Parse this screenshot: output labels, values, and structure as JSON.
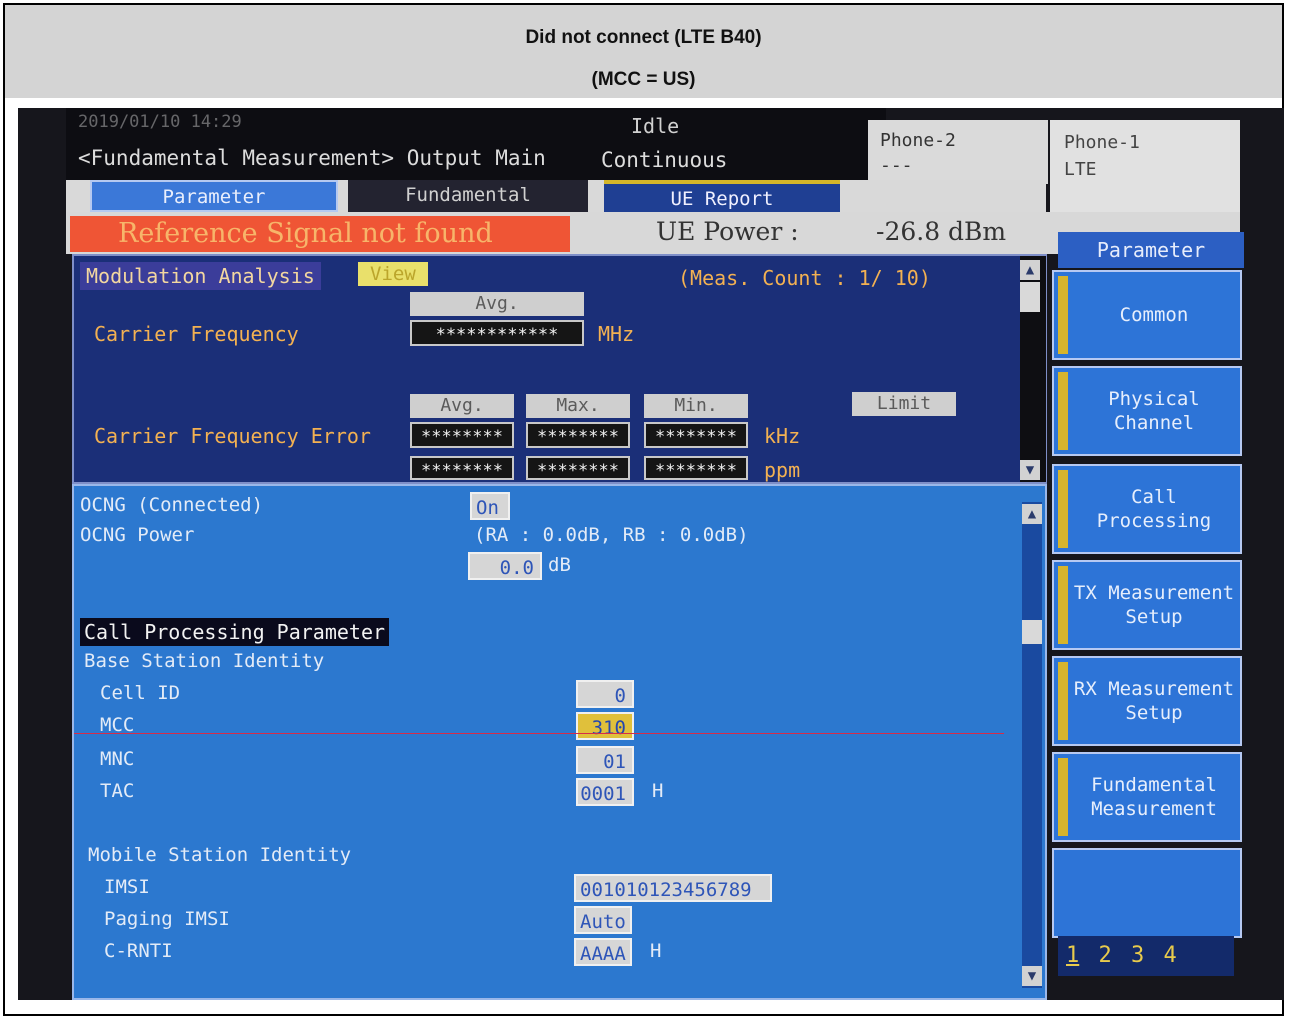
{
  "caption": {
    "title": "Did not connect (LTE B40)",
    "subtitle": "(MCC = US)"
  },
  "status_bar": {
    "timestamp_faded": "2019/01/10 14:29",
    "screen_title": "<Fundamental Measurement> Output Main",
    "state": "Idle",
    "mode": "Continuous",
    "phone2": {
      "label": "Phone-2",
      "value": "---"
    },
    "phone1": {
      "label": "Phone-1",
      "value": "LTE"
    }
  },
  "tabs": [
    {
      "label": "Parameter"
    },
    {
      "label": "Fundamental"
    },
    {
      "label": "UE Report"
    }
  ],
  "alert": {
    "text": "Reference Signal not found",
    "ue_power_label": "UE Power :",
    "ue_power_value": "-26.8 dBm"
  },
  "modulation": {
    "title": "Modulation Analysis",
    "view_label": "View",
    "meas_count": "(Meas. Count :   1/  10)",
    "avg_header": "Avg.",
    "carrier_frequency_label": "Carrier Frequency",
    "carrier_frequency_value": "************",
    "carrier_frequency_unit": "MHz",
    "headers": [
      "Avg.",
      "Max.",
      "Min."
    ],
    "limit_label": "Limit",
    "cfe_label": "Carrier Frequency Error",
    "cfe_values": [
      "********",
      "********",
      "********"
    ],
    "cfe_unit": "kHz",
    "cfe_values_row2": [
      "********",
      "********",
      "********"
    ],
    "cfe_unit_row2": "ppm"
  },
  "params": {
    "ocng_connected_label": "OCNG (Connected)",
    "ocng_connected_value": "On",
    "ocng_power_label": "OCNG Power",
    "ocng_power_info": "(RA :      0.0dB, RB :       0.0dB)",
    "ocng_power_value": "0.0",
    "ocng_power_unit": "dB",
    "section_title": "Call Processing Parameter",
    "bs_identity": "Base Station Identity",
    "cell_id_label": "Cell ID",
    "cell_id_value": "0",
    "mcc_label": "MCC",
    "mcc_value": "310",
    "mnc_label": "MNC",
    "mnc_value": "01",
    "tac_label": "TAC",
    "tac_value": "0001",
    "tac_unit": "H",
    "ms_identity": "Mobile Station Identity",
    "imsi_label": "IMSI",
    "imsi_value": "001010123456789",
    "paging_imsi_label": "Paging IMSI",
    "paging_imsi_value": "Auto",
    "crnti_label": "C-RNTI",
    "crnti_value": "AAAA",
    "crnti_unit": "H"
  },
  "sidebar": {
    "header": "Parameter",
    "buttons": [
      {
        "label": "Common"
      },
      {
        "label": "Physical Channel"
      },
      {
        "label": "Call Processing"
      },
      {
        "label": "TX Measurement Setup"
      },
      {
        "label": "RX Measurement Setup"
      },
      {
        "label": "Fundamental Measurement"
      },
      {
        "label": ""
      }
    ],
    "pages": [
      "1",
      "2",
      "3",
      "4"
    ]
  },
  "colors": {
    "panel_blue": "#2c78cf",
    "alert_red": "#ef5535",
    "highlight_yellow": "#e0c03b",
    "label_orange": "#f3b152"
  }
}
